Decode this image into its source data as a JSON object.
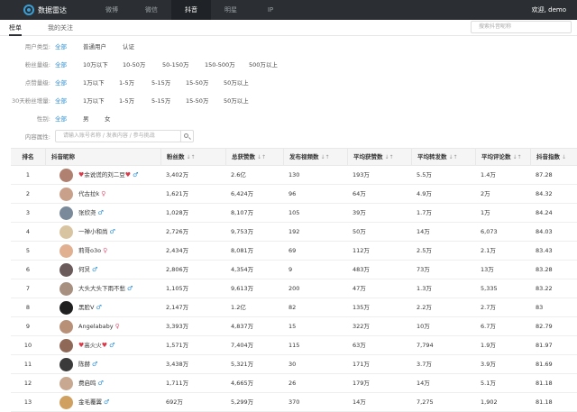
{
  "app": {
    "logo_text": "数据雷达"
  },
  "nav": {
    "items": [
      {
        "label": "微博"
      },
      {
        "label": "微信"
      },
      {
        "label": "抖音"
      },
      {
        "label": "明星"
      },
      {
        "label": "IP"
      }
    ],
    "active_index": 2
  },
  "user": {
    "greeting": "欢迎,",
    "name": "demo"
  },
  "subtabs": [
    {
      "label": "榜单"
    },
    {
      "label": "我的关注"
    }
  ],
  "search": {
    "placeholder": "搜索抖音昵称"
  },
  "filters": {
    "user_type": {
      "label": "用户类型:",
      "options": [
        "全部",
        "普通用户",
        "认证"
      ]
    },
    "fans": {
      "label": "粉丝量级:",
      "options": [
        "全部",
        "10万以下",
        "10-50万",
        "50-150万",
        "150-500万",
        "500万以上"
      ]
    },
    "likes": {
      "label": "点赞量级:",
      "options": [
        "全部",
        "1万以下",
        "1-5万",
        "5-15万",
        "15-50万",
        "50万以上"
      ]
    },
    "fans_growth": {
      "label": "30天粉丝增量:",
      "options": [
        "全部",
        "1万以下",
        "1-5万",
        "5-15万",
        "15-50万",
        "50万以上"
      ]
    },
    "gender": {
      "label": "性别:",
      "options": [
        "全部",
        "男",
        "女"
      ]
    },
    "content": {
      "label": "内容属性:",
      "placeholder": "请输入账号名称 / 发表内容 / 参与挑战"
    }
  },
  "table": {
    "headers": [
      "排名",
      "抖音昵称",
      "粉丝数",
      "总获赞数",
      "发布视频数",
      "平均获赞数",
      "平均转发数",
      "平均评论数",
      "抖音指数"
    ],
    "sort_icon": "↓↑",
    "sort_desc_icon": "↓",
    "rows": [
      {
        "rank": "1",
        "name": "余说谎的刘二豆",
        "gender": "m",
        "hearts": true,
        "fans": "3,402万",
        "likes": "2.6亿",
        "videos": "130",
        "avg_likes": "193万",
        "avg_share": "5.5万",
        "avg_comment": "1.4万",
        "index": "87.28",
        "avatar_color": "#b08070"
      },
      {
        "rank": "2",
        "name": "代古拉k",
        "gender": "f",
        "hearts": false,
        "fans": "1,621万",
        "likes": "6,424万",
        "videos": "96",
        "avg_likes": "64万",
        "avg_share": "4.9万",
        "avg_comment": "2万",
        "index": "84.32",
        "avatar_color": "#c9a08a"
      },
      {
        "rank": "3",
        "name": "张欣尧",
        "gender": "m",
        "hearts": false,
        "fans": "1,028万",
        "likes": "8,107万",
        "videos": "105",
        "avg_likes": "39万",
        "avg_share": "1.7万",
        "avg_comment": "1万",
        "index": "84.24",
        "avatar_color": "#7a8a9a"
      },
      {
        "rank": "4",
        "name": "一禅小和尚",
        "gender": "m",
        "hearts": false,
        "fans": "2,726万",
        "likes": "9,753万",
        "videos": "192",
        "avg_likes": "50万",
        "avg_share": "14万",
        "avg_comment": "6,073",
        "index": "84.03",
        "avatar_color": "#d8c4a0"
      },
      {
        "rank": "5",
        "name": "莉哥o3o",
        "gender": "f",
        "hearts": false,
        "fans": "2,434万",
        "likes": "8,081万",
        "videos": "69",
        "avg_likes": "112万",
        "avg_share": "2.5万",
        "avg_comment": "2.1万",
        "index": "83.43",
        "avatar_color": "#e0b090"
      },
      {
        "rank": "6",
        "name": "何炅",
        "gender": "m",
        "hearts": false,
        "fans": "2,806万",
        "likes": "4,354万",
        "videos": "9",
        "avg_likes": "483万",
        "avg_share": "73万",
        "avg_comment": "13万",
        "index": "83.28",
        "avatar_color": "#6a5a5a"
      },
      {
        "rank": "7",
        "name": "大头大头下雨不愁",
        "gender": "m",
        "hearts": false,
        "fans": "1,105万",
        "likes": "9,613万",
        "videos": "200",
        "avg_likes": "47万",
        "avg_share": "1.3万",
        "avg_comment": "5,335",
        "index": "83.22",
        "avatar_color": "#a89080"
      },
      {
        "rank": "8",
        "name": "黑脸V",
        "gender": "m",
        "hearts": false,
        "fans": "2,147万",
        "likes": "1.2亿",
        "videos": "82",
        "avg_likes": "135万",
        "avg_share": "2.2万",
        "avg_comment": "2.7万",
        "index": "83",
        "avatar_color": "#202020"
      },
      {
        "rank": "9",
        "name": "Angelababy",
        "gender": "f",
        "hearts": false,
        "fans": "3,393万",
        "likes": "4,837万",
        "videos": "15",
        "avg_likes": "322万",
        "avg_share": "10万",
        "avg_comment": "6.7万",
        "index": "82.79",
        "avatar_color": "#b89078"
      },
      {
        "rank": "10",
        "name": "高火火",
        "gender": "m",
        "hearts": true,
        "fans": "1,571万",
        "likes": "7,404万",
        "videos": "115",
        "avg_likes": "63万",
        "avg_share": "7,794",
        "avg_comment": "1.9万",
        "index": "81.97",
        "avatar_color": "#906858"
      },
      {
        "rank": "11",
        "name": "陈赫",
        "gender": "m",
        "hearts": false,
        "fans": "3,438万",
        "likes": "5,321万",
        "videos": "30",
        "avg_likes": "171万",
        "avg_share": "3.7万",
        "avg_comment": "3.9万",
        "index": "81.69",
        "avatar_color": "#3a3a3a"
      },
      {
        "rank": "12",
        "name": "费启鸣",
        "gender": "m",
        "hearts": false,
        "fans": "1,711万",
        "likes": "4,665万",
        "videos": "26",
        "avg_likes": "179万",
        "avg_share": "14万",
        "avg_comment": "5.1万",
        "index": "81.18",
        "avatar_color": "#c8a890"
      },
      {
        "rank": "13",
        "name": "金毛覆翼",
        "gender": "m",
        "hearts": false,
        "fans": "692万",
        "likes": "5,299万",
        "videos": "370",
        "avg_likes": "14万",
        "avg_share": "7,275",
        "avg_comment": "1,902",
        "index": "81.18",
        "avatar_color": "#d0a060"
      }
    ]
  }
}
